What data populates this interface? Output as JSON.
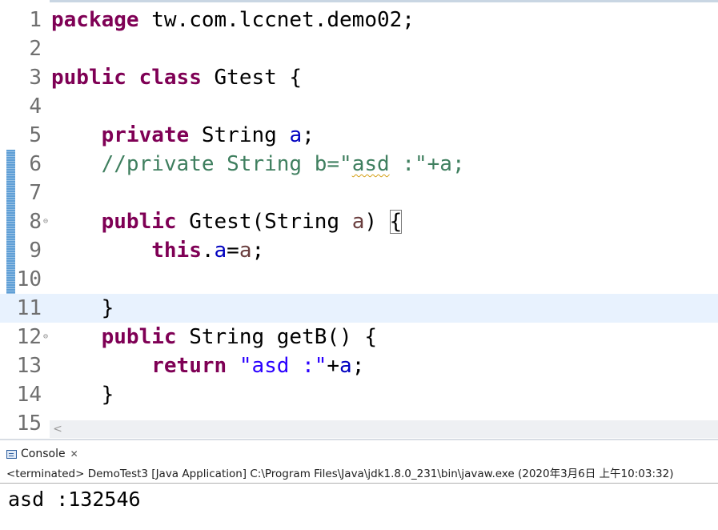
{
  "editor": {
    "lines": [
      {
        "n": "1",
        "fold": false,
        "current": false,
        "marked": false,
        "tokens": [
          {
            "t": "kw",
            "v": "package"
          },
          {
            "t": "p",
            "v": " tw.com.lccnet.demo02;"
          }
        ]
      },
      {
        "n": "2",
        "fold": false,
        "current": false,
        "marked": false,
        "tokens": []
      },
      {
        "n": "3",
        "fold": false,
        "current": false,
        "marked": false,
        "tokens": [
          {
            "t": "kw",
            "v": "public"
          },
          {
            "t": "p",
            "v": " "
          },
          {
            "t": "kw",
            "v": "class"
          },
          {
            "t": "p",
            "v": " Gtest {"
          }
        ]
      },
      {
        "n": "4",
        "fold": false,
        "current": false,
        "marked": false,
        "tokens": []
      },
      {
        "n": "5",
        "fold": false,
        "current": false,
        "marked": false,
        "tokens": [
          {
            "t": "p",
            "v": "    "
          },
          {
            "t": "kw",
            "v": "private"
          },
          {
            "t": "p",
            "v": " String "
          },
          {
            "t": "fld",
            "v": "a"
          },
          {
            "t": "p",
            "v": ";"
          }
        ]
      },
      {
        "n": "6",
        "fold": false,
        "current": false,
        "marked": true,
        "tokens": [
          {
            "t": "p",
            "v": "    "
          },
          {
            "t": "cm",
            "v": "//private String b=\""
          },
          {
            "t": "cmsq",
            "v": "asd"
          },
          {
            "t": "cm",
            "v": " :\"+a;"
          }
        ]
      },
      {
        "n": "7",
        "fold": false,
        "current": false,
        "marked": true,
        "tokens": []
      },
      {
        "n": "8",
        "fold": true,
        "current": false,
        "marked": true,
        "tokens": [
          {
            "t": "p",
            "v": "    "
          },
          {
            "t": "kw",
            "v": "public"
          },
          {
            "t": "p",
            "v": " Gtest(String "
          },
          {
            "t": "prm",
            "v": "a"
          },
          {
            "t": "p",
            "v": ") "
          },
          {
            "t": "brk",
            "v": "{"
          }
        ]
      },
      {
        "n": "9",
        "fold": false,
        "current": false,
        "marked": true,
        "tokens": [
          {
            "t": "p",
            "v": "        "
          },
          {
            "t": "kw",
            "v": "this"
          },
          {
            "t": "p",
            "v": "."
          },
          {
            "t": "fld",
            "v": "a"
          },
          {
            "t": "p",
            "v": "="
          },
          {
            "t": "prm",
            "v": "a"
          },
          {
            "t": "p",
            "v": ";"
          }
        ]
      },
      {
        "n": "10",
        "fold": false,
        "current": false,
        "marked": true,
        "tokens": []
      },
      {
        "n": "11",
        "fold": false,
        "current": true,
        "marked": true,
        "tokens": [
          {
            "t": "p",
            "v": "    }"
          }
        ]
      },
      {
        "n": "12",
        "fold": true,
        "current": false,
        "marked": false,
        "tokens": [
          {
            "t": "p",
            "v": "    "
          },
          {
            "t": "kw",
            "v": "public"
          },
          {
            "t": "p",
            "v": " String getB() {"
          }
        ]
      },
      {
        "n": "13",
        "fold": false,
        "current": false,
        "marked": false,
        "tokens": [
          {
            "t": "p",
            "v": "        "
          },
          {
            "t": "kw",
            "v": "return"
          },
          {
            "t": "p",
            "v": " "
          },
          {
            "t": "str",
            "v": "\"asd :\""
          },
          {
            "t": "p",
            "v": "+"
          },
          {
            "t": "fld",
            "v": "a"
          },
          {
            "t": "p",
            "v": ";"
          }
        ]
      },
      {
        "n": "14",
        "fold": false,
        "current": false,
        "marked": false,
        "tokens": [
          {
            "t": "p",
            "v": "    }"
          }
        ]
      },
      {
        "n": "15",
        "fold": false,
        "current": false,
        "marked": false,
        "tokens": []
      }
    ],
    "scroll_left_glyph": "<"
  },
  "console": {
    "tab_label": "Console",
    "close_glyph": "✕",
    "status": "<terminated> DemoTest3 [Java Application] C:\\Program Files\\Java\\jdk1.8.0_231\\bin\\javaw.exe (2020年3月6日 上午10:03:32)",
    "output": "asd :132546"
  },
  "colors": {
    "keyword": "#7f0055",
    "comment": "#3f7f5f",
    "string": "#2a00ff",
    "field": "#0000c0",
    "current_line": "#e8f2fe",
    "change_marker": "#5f9fd6"
  }
}
